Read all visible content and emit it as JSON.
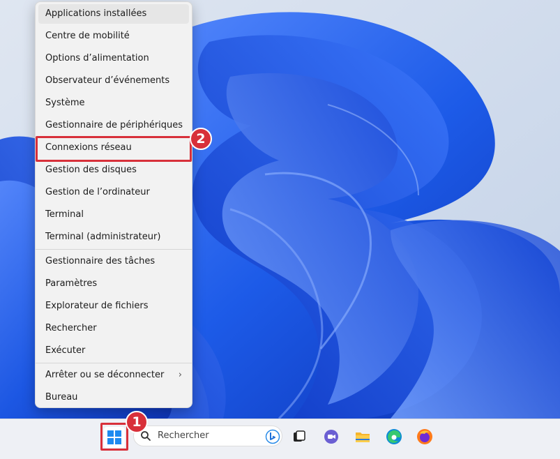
{
  "menu": {
    "items": [
      {
        "label": "Applications installées"
      },
      {
        "label": "Centre de mobilité"
      },
      {
        "label": "Options d’alimentation"
      },
      {
        "label": "Observateur d’événements"
      },
      {
        "label": "Système"
      },
      {
        "label": "Gestionnaire de périphériques"
      },
      {
        "label": "Connexions réseau"
      },
      {
        "label": "Gestion des disques"
      },
      {
        "label": "Gestion de l’ordinateur"
      },
      {
        "label": "Terminal"
      },
      {
        "label": "Terminal (administrateur)"
      },
      {
        "label": "Gestionnaire des tâches"
      },
      {
        "label": "Paramètres"
      },
      {
        "label": "Explorateur de fichiers"
      },
      {
        "label": "Rechercher"
      },
      {
        "label": "Exécuter"
      },
      {
        "label": "Arrêter ou se déconnecter",
        "submenu_glyph": "›"
      },
      {
        "label": "Bureau"
      }
    ]
  },
  "callouts": {
    "step1": "1",
    "step2": "2",
    "color": "#d8303a"
  },
  "taskbar": {
    "search_placeholder": "Rechercher",
    "icons": [
      "windows-start-icon",
      "search-icon",
      "bing-icon",
      "task-view-icon",
      "teams-chat-icon",
      "file-explorer-icon",
      "edge-icon",
      "firefox-icon"
    ]
  },
  "colors": {
    "wallpaper_bg": "#c9d7ea",
    "bloom": "#1f57e0",
    "accent": "#d8303a"
  }
}
